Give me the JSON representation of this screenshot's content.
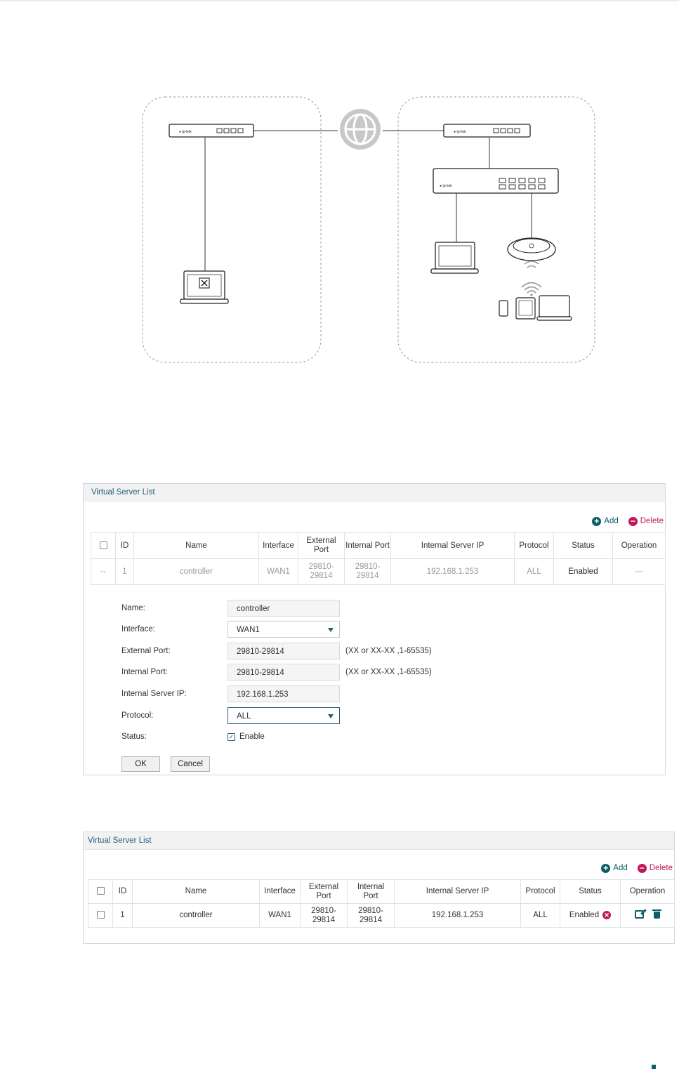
{
  "panel1": {
    "title": "Virtual Server List",
    "add_label": "Add",
    "delete_label": "Delete",
    "columns": [
      "ID",
      "Name",
      "Interface",
      "External Port",
      "Internal Port",
      "Internal Server IP",
      "Protocol",
      "Status",
      "Operation"
    ],
    "row": {
      "select": "--",
      "id": "1",
      "name": "controller",
      "interface": "WAN1",
      "external_port": "29810-29814",
      "internal_port": "29810-29814",
      "internal_server_ip": "192.168.1.253",
      "protocol": "ALL",
      "status": "Enabled",
      "operation": "---"
    },
    "form": {
      "name_label": "Name:",
      "name_value": "controller",
      "interface_label": "Interface:",
      "interface_value": "WAN1",
      "external_port_label": "External Port:",
      "external_port_value": "29810-29814",
      "external_port_hint": "(XX or XX-XX ,1-65535)",
      "internal_port_label": "Internal Port:",
      "internal_port_value": "29810-29814",
      "internal_port_hint": "(XX or XX-XX ,1-65535)",
      "ip_label": "Internal Server IP:",
      "ip_value": "192.168.1.253",
      "protocol_label": "Protocol:",
      "protocol_value": "ALL",
      "status_label": "Status:",
      "status_checkbox_label": "Enable",
      "ok_label": "OK",
      "cancel_label": "Cancel"
    }
  },
  "panel2": {
    "title": "Virtual Server List",
    "add_label": "Add",
    "delete_label": "Delete",
    "columns": [
      "ID",
      "Name",
      "Interface",
      "External Port",
      "Internal Port",
      "Internal Server IP",
      "Protocol",
      "Status",
      "Operation"
    ],
    "row": {
      "id": "1",
      "name": "controller",
      "interface": "WAN1",
      "external_port": "29810-29814",
      "internal_port": "29810-29814",
      "internal_server_ip": "192.168.1.253",
      "protocol": "ALL",
      "status": "Enabled"
    }
  },
  "diagram": {
    "router_brand": "tp-link",
    "icons": [
      "router-icon",
      "globe-icon",
      "switch-icon",
      "laptop-icon",
      "access-point-icon",
      "phone-icon",
      "tablet-icon"
    ]
  },
  "colors": {
    "accent": "#0e5e6a",
    "delete": "#c2185b",
    "header_text": "#1f5f7a"
  }
}
